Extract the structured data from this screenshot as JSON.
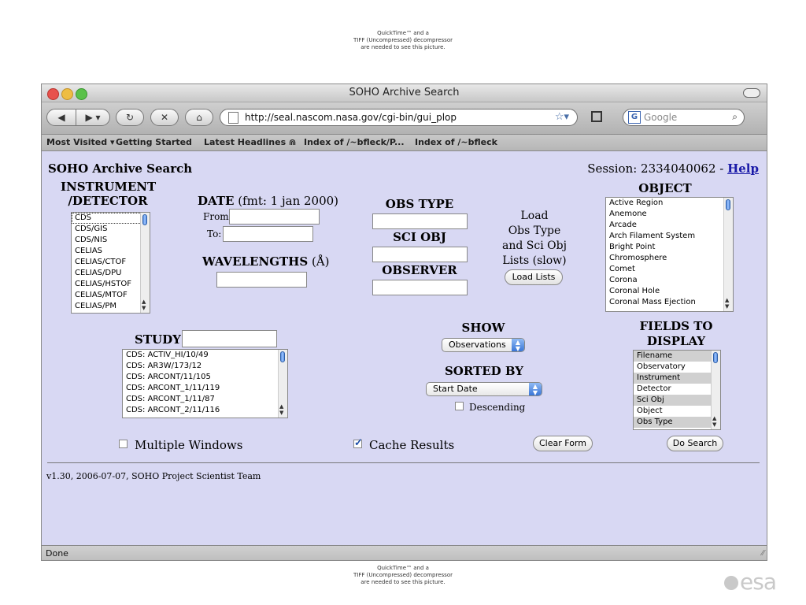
{
  "quicktime_top": [
    "QuickTime™ and a",
    "TIFF (Uncompressed) decompressor",
    "are needed to see this picture."
  ],
  "quicktime_bottom": [
    "QuickTime™ and a",
    "TIFF (Uncompressed) decompressor",
    "are needed to see this picture."
  ],
  "logo": "esa",
  "window": {
    "title": "SOHO Archive Search"
  },
  "toolbar": {
    "url": "http://seal.nascom.nasa.gov/cgi-bin/gui_plop",
    "search_placeholder": "Google"
  },
  "bookmarks": [
    "Most Visited ▾",
    "Getting Started",
    "Latest Headlines ⋒",
    "Index of /~bfleck/P...",
    "Index of /~bfleck"
  ],
  "page": {
    "title": "SOHO Archive Search",
    "session_text": "Session: 2334040062 - ",
    "help_link": "Help",
    "instrument_label_1": "INSTRUMENT",
    "instrument_label_2": "/DETECTOR",
    "instruments": [
      "CDS",
      "CDS/GIS",
      "CDS/NIS",
      "CELIAS",
      "CELIAS/CTOF",
      "CELIAS/DPU",
      "CELIAS/HSTOF",
      "CELIAS/MTOF",
      "CELIAS/PM"
    ],
    "date_label": "DATE",
    "date_fmt": " (fmt: 1 jan 2000)",
    "from_label": "From:",
    "to_label": "To:",
    "wavelengths_label": "WAVELENGTHS",
    "wavelengths_unit": " (Å)",
    "obs_type_label": "OBS TYPE",
    "sci_obj_label": "SCI OBJ",
    "observer_label": "OBSERVER",
    "load_text": [
      "Load",
      "Obs Type",
      "and Sci Obj",
      "Lists (slow)"
    ],
    "load_lists_button": "Load Lists",
    "object_label": "OBJECT",
    "objects": [
      "Active Region",
      "Anemone",
      "Arcade",
      "Arch Filament System",
      "Bright Point",
      "Chromosphere",
      "Comet",
      "Corona",
      "Coronal Hole",
      "Coronal Mass Ejection"
    ],
    "study_label": "STUDY",
    "studies": [
      "CDS: ACTIV_HI/10/49",
      "CDS: AR3W/173/12",
      "CDS: ARCONT/11/105",
      "CDS: ARCONT_1/11/119",
      "CDS: ARCONT_1/11/87",
      "CDS: ARCONT_2/11/116"
    ],
    "show_label": "SHOW",
    "show_value": "Observations",
    "sorted_by_label": "SORTED BY",
    "sorted_by_value": "Start Date",
    "descending_label": "Descending",
    "fields_label_1": "FIELDS TO",
    "fields_label_2": "DISPLAY",
    "fields": [
      "Filename",
      "Observatory",
      "Instrument",
      "Detector",
      "Sci Obj",
      "Object",
      "Obs Type"
    ],
    "multiple_windows_label": "Multiple Windows",
    "cache_results_label": "Cache Results",
    "clear_form_button": "Clear Form",
    "do_search_button": "Do Search",
    "footer": "v1.30, 2006-07-07, SOHO Project Scientist Team"
  },
  "status": "Done"
}
